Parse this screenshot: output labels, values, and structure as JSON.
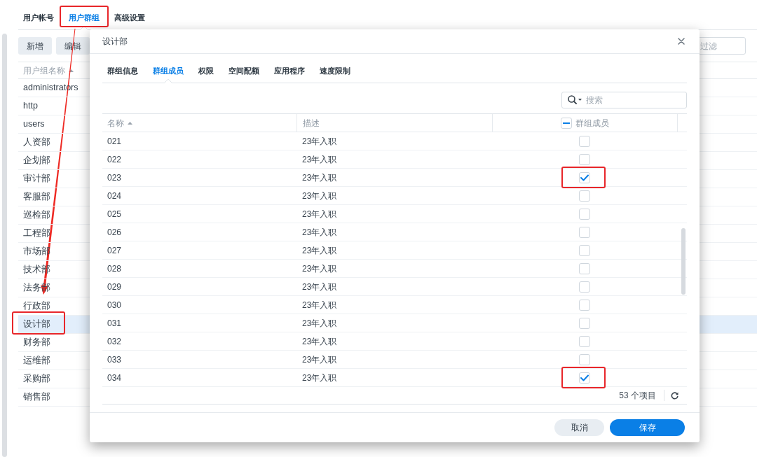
{
  "page": {
    "tabs": [
      {
        "label": "用户帐号",
        "selected": false,
        "highlighted": false
      },
      {
        "label": "用户群组",
        "selected": true,
        "highlighted": true
      },
      {
        "label": "高级设置",
        "selected": false,
        "highlighted": false
      }
    ],
    "toolbar": {
      "buttons": [
        "新增",
        "编辑"
      ],
      "filter": {
        "placeholder": "过滤"
      }
    },
    "group_list": {
      "column": {
        "label": "用户组名称",
        "sorted": true
      },
      "items": [
        {
          "name": "administrators",
          "selected": false,
          "highlighted": false
        },
        {
          "name": "http",
          "selected": false,
          "highlighted": false
        },
        {
          "name": "users",
          "selected": false,
          "highlighted": false
        },
        {
          "name": "人资部",
          "selected": false,
          "highlighted": false
        },
        {
          "name": "企划部",
          "selected": false,
          "highlighted": false
        },
        {
          "name": "审计部",
          "selected": false,
          "highlighted": false
        },
        {
          "name": "客服部",
          "selected": false,
          "highlighted": false
        },
        {
          "name": "巡检部",
          "selected": false,
          "highlighted": false
        },
        {
          "name": "工程部",
          "selected": false,
          "highlighted": false
        },
        {
          "name": "市场部",
          "selected": false,
          "highlighted": false
        },
        {
          "name": "技术部",
          "selected": false,
          "highlighted": false
        },
        {
          "name": "法务部",
          "selected": false,
          "highlighted": false
        },
        {
          "name": "行政部",
          "selected": false,
          "highlighted": false
        },
        {
          "name": "设计部",
          "selected": true,
          "highlighted": true
        },
        {
          "name": "财务部",
          "selected": false,
          "highlighted": false
        },
        {
          "name": "运维部",
          "selected": false,
          "highlighted": false
        },
        {
          "name": "采购部",
          "selected": false,
          "highlighted": false
        },
        {
          "name": "销售部",
          "selected": false,
          "highlighted": false
        }
      ]
    }
  },
  "dialog": {
    "title": "设计部",
    "tabs": [
      {
        "label": "群组信息",
        "selected": false
      },
      {
        "label": "群组成员",
        "selected": true
      },
      {
        "label": "权限",
        "selected": false
      },
      {
        "label": "空间配额",
        "selected": false
      },
      {
        "label": "应用程序",
        "selected": false
      },
      {
        "label": "速度限制",
        "selected": false
      }
    ],
    "search": {
      "placeholder": "搜索"
    },
    "table": {
      "columns": [
        {
          "label": "名称",
          "sorted": true
        },
        {
          "label": "描述",
          "sorted": false
        },
        {
          "label": "群组成员",
          "kind": "checkbox",
          "indeterminate": true
        }
      ],
      "rows": [
        {
          "name": "021",
          "description": "23年入职",
          "checked": false,
          "highlighted": false
        },
        {
          "name": "022",
          "description": "23年入职",
          "checked": false,
          "highlighted": false
        },
        {
          "name": "023",
          "description": "23年入职",
          "checked": true,
          "highlighted": true
        },
        {
          "name": "024",
          "description": "23年入职",
          "checked": false,
          "highlighted": false
        },
        {
          "name": "025",
          "description": "23年入职",
          "checked": false,
          "highlighted": false
        },
        {
          "name": "026",
          "description": "23年入职",
          "checked": false,
          "highlighted": false
        },
        {
          "name": "027",
          "description": "23年入职",
          "checked": false,
          "highlighted": false
        },
        {
          "name": "028",
          "description": "23年入职",
          "checked": false,
          "highlighted": false
        },
        {
          "name": "029",
          "description": "23年入职",
          "checked": false,
          "highlighted": false
        },
        {
          "name": "030",
          "description": "23年入职",
          "checked": false,
          "highlighted": false
        },
        {
          "name": "031",
          "description": "23年入职",
          "checked": false,
          "highlighted": false
        },
        {
          "name": "032",
          "description": "23年入职",
          "checked": false,
          "highlighted": false
        },
        {
          "name": "033",
          "description": "23年入职",
          "checked": false,
          "highlighted": false
        },
        {
          "name": "034",
          "description": "23年入职",
          "checked": true,
          "highlighted": true
        }
      ],
      "count": "53 个项目"
    },
    "buttons": [
      {
        "label": "取消",
        "kind": "secondary"
      },
      {
        "label": "保存",
        "kind": "primary"
      }
    ]
  },
  "annotations": {
    "arrow": true
  }
}
